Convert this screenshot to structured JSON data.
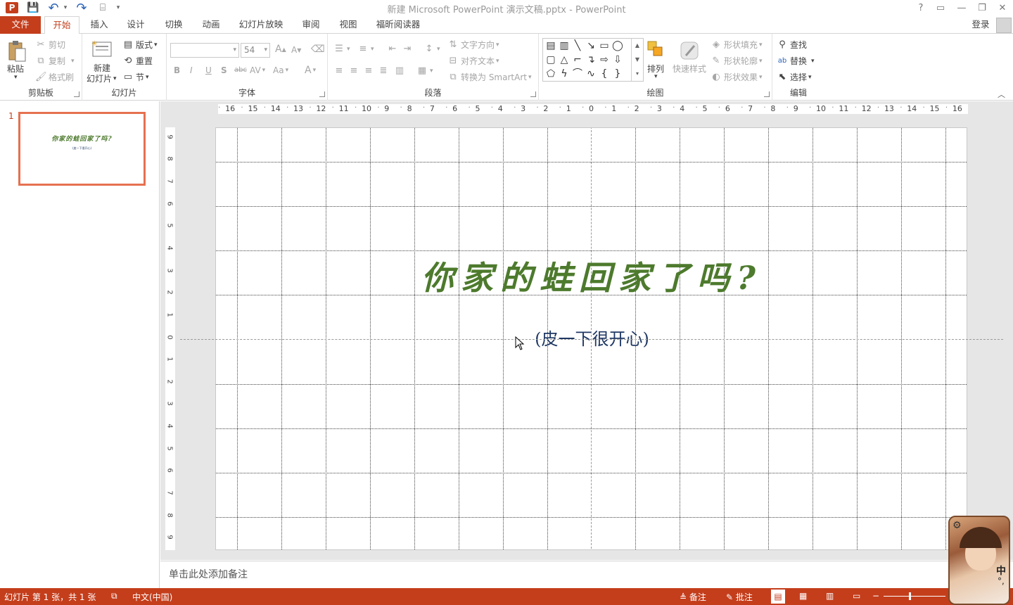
{
  "window": {
    "title": "新建 Microsoft PowerPoint 演示文稿.pptx - PowerPoint",
    "controls": {
      "help": "?",
      "restore_ribbon": "▭",
      "minimize": "—",
      "maximize": "❐",
      "close": "✕"
    }
  },
  "quick_access": {
    "app_icon": "P",
    "save": "💾",
    "undo": "↶",
    "redo": "↷",
    "present": "⌸",
    "customize": "▾"
  },
  "tabs": [
    {
      "label": "文件"
    },
    {
      "label": "开始"
    },
    {
      "label": "插入"
    },
    {
      "label": "设计"
    },
    {
      "label": "切换"
    },
    {
      "label": "动画"
    },
    {
      "label": "幻灯片放映"
    },
    {
      "label": "审阅"
    },
    {
      "label": "视图"
    },
    {
      "label": "福昕阅读器"
    }
  ],
  "account": {
    "signin": "登录"
  },
  "ribbon": {
    "clipboard": {
      "paste": "粘贴",
      "cut": "剪切",
      "copy": "复制",
      "format_painter": "格式刷",
      "group": "剪贴板"
    },
    "slides": {
      "new_slide_1": "新建",
      "new_slide_2": "幻灯片",
      "layout": "版式",
      "reset": "重置",
      "section": "节",
      "group": "幻灯片"
    },
    "font": {
      "font_name": "",
      "font_size": "54",
      "grow": "A",
      "shrink": "A",
      "clear": "A",
      "bold": "B",
      "italic": "I",
      "underline": "U",
      "shadow": "S",
      "strike": "abc",
      "spacing": "AV",
      "case": "Aa",
      "color": "A",
      "group": "字体"
    },
    "paragraph": {
      "text_direction": "文字方向",
      "align_text": "对齐文本",
      "convert_smartart": "转换为 SmartArt",
      "group": "段落"
    },
    "drawing": {
      "arrange": "排列",
      "quick_styles": "快速样式",
      "shape_fill": "形状填充",
      "shape_outline": "形状轮廓",
      "shape_effects": "形状效果",
      "group": "绘图"
    },
    "editing": {
      "find": "查找",
      "replace": "替换",
      "select": "选择",
      "group": "编辑"
    }
  },
  "thumbnail": {
    "number": "1",
    "title": "你家的蛙回家了吗?",
    "subtitle": "(皮一下很开心)"
  },
  "ruler": {
    "h_labels": [
      "16",
      "15",
      "14",
      "13",
      "12",
      "11",
      "10",
      "9",
      "8",
      "7",
      "6",
      "5",
      "4",
      "3",
      "2",
      "1",
      "0",
      "1",
      "2",
      "3",
      "4",
      "5",
      "6",
      "7",
      "8",
      "9",
      "10",
      "11",
      "12",
      "13",
      "14",
      "15",
      "16"
    ],
    "v_labels": [
      "9",
      "8",
      "7",
      "6",
      "5",
      "4",
      "3",
      "2",
      "1",
      "0",
      "1",
      "2",
      "3",
      "4",
      "5",
      "6",
      "7",
      "8",
      "9"
    ]
  },
  "slide": {
    "title": "你家的蛙回家了吗?",
    "subtitle": "(皮一下很开心)"
  },
  "notes": {
    "placeholder": "单击此处添加备注"
  },
  "status": {
    "slide_info": "幻灯片 第 1 张，共 1 张",
    "language": "中文(中国)",
    "notes": "备注",
    "comments": "批注"
  },
  "colors": {
    "accent": "#c43e1c",
    "title_green": "#4d7a2d",
    "subtitle_navy": "#1f3864",
    "thumb_border": "#e57150"
  },
  "avatar_widget": {
    "ime_label": "中",
    "punct": "°,"
  }
}
